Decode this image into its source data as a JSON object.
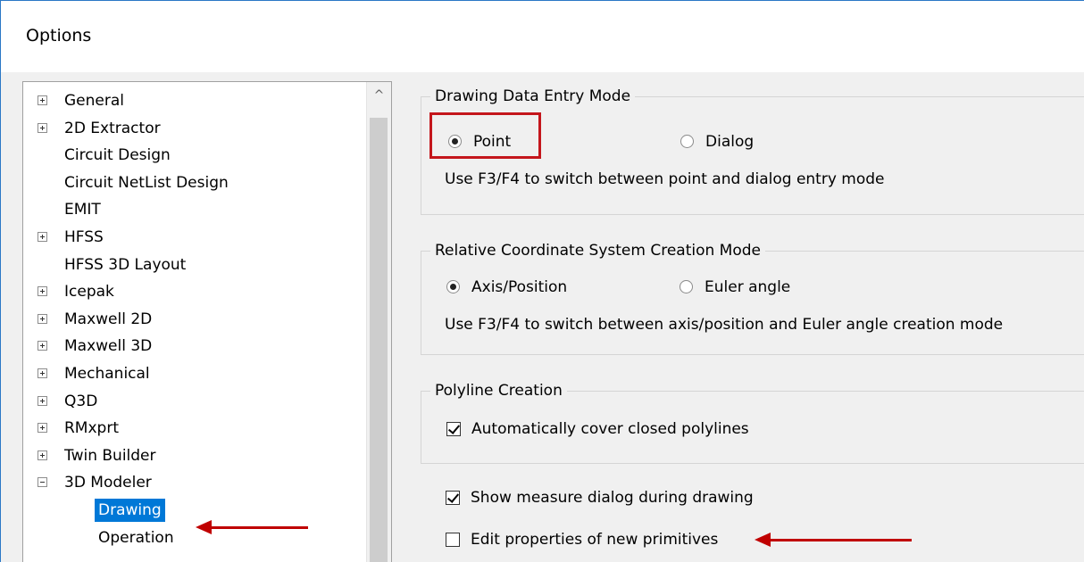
{
  "window": {
    "title": "Options"
  },
  "tree": {
    "items": [
      {
        "label": "General",
        "expander": "plus"
      },
      {
        "label": "2D Extractor",
        "expander": "plus"
      },
      {
        "label": "Circuit Design",
        "expander": ""
      },
      {
        "label": "Circuit NetList Design",
        "expander": ""
      },
      {
        "label": "EMIT",
        "expander": ""
      },
      {
        "label": "HFSS",
        "expander": "plus"
      },
      {
        "label": "HFSS 3D Layout",
        "expander": ""
      },
      {
        "label": "Icepak",
        "expander": "plus"
      },
      {
        "label": "Maxwell 2D",
        "expander": "plus"
      },
      {
        "label": "Maxwell 3D",
        "expander": "plus"
      },
      {
        "label": "Mechanical",
        "expander": "plus"
      },
      {
        "label": "Q3D",
        "expander": "plus"
      },
      {
        "label": "RMxprt",
        "expander": "plus"
      },
      {
        "label": "Twin Builder",
        "expander": "plus"
      },
      {
        "label": "3D Modeler",
        "expander": "minus"
      },
      {
        "label": "Drawing",
        "expander": "",
        "selected": true
      },
      {
        "label": "Operation",
        "expander": ""
      }
    ],
    "scroll_up_glyph": "^"
  },
  "drawing_entry": {
    "title": "Drawing Data Entry Mode",
    "point_label": "Point",
    "dialog_label": "Dialog",
    "selected": "Point",
    "hint": "Use F3/F4 to switch between point and dialog entry mode"
  },
  "relative_cs": {
    "title": "Relative Coordinate System Creation Mode",
    "axis_label": "Axis/Position",
    "euler_label": "Euler angle",
    "selected": "Axis/Position",
    "hint": "Use F3/F4 to switch between axis/position and Euler angle creation mode"
  },
  "polyline": {
    "title": "Polyline Creation",
    "cover_label": "Automatically cover closed polylines",
    "cover_checked": true
  },
  "options": {
    "show_measure_label": "Show measure dialog during drawing",
    "show_measure_checked": true,
    "edit_props_label": "Edit properties of new primitives",
    "edit_props_checked": false
  },
  "colors": {
    "selection": "#0078d7",
    "annotation_red": "#c4161c",
    "dialog_bg": "#f0f0f0",
    "window_border": "#2b78c6"
  }
}
